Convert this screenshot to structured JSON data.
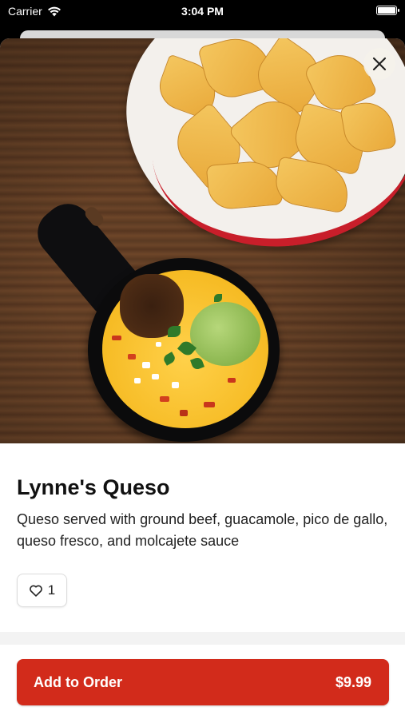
{
  "status_bar": {
    "carrier": "Carrier",
    "time": "3:04 PM"
  },
  "item": {
    "title": "Lynne's Queso",
    "description": "Queso served with ground beef, guacamole, pico de gallo, queso fresco, and molcajete sauce",
    "like_count": "1",
    "image_icon": "queso-photo"
  },
  "actions": {
    "close_icon": "close-icon",
    "add_label": "Add to Order",
    "price": "$9.99"
  },
  "colors": {
    "accent": "#d22b1b"
  }
}
